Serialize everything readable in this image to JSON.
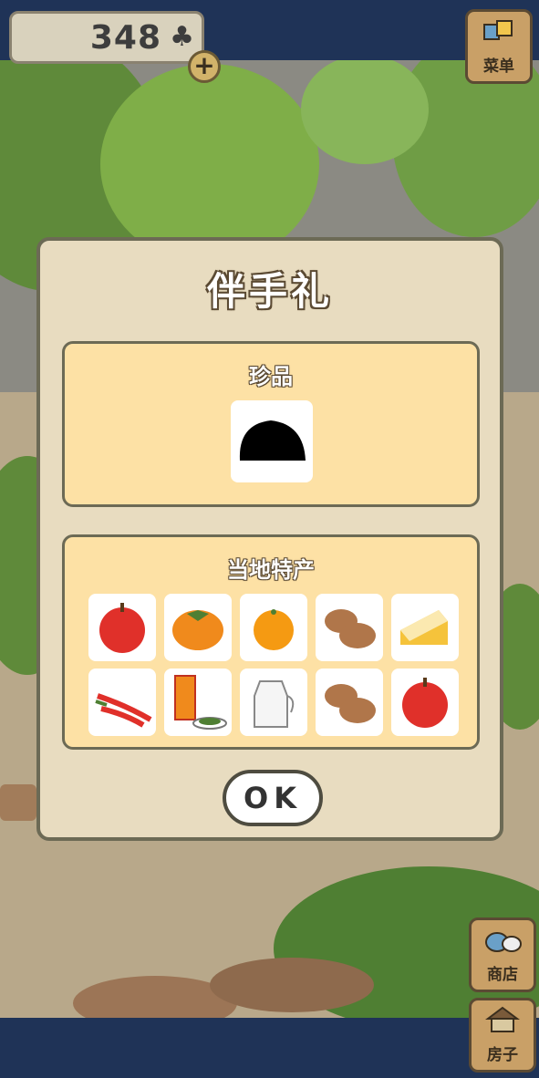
{
  "hud": {
    "clover_count": "348",
    "clover_icon": "♣",
    "add_label": "+"
  },
  "menu": {
    "label": "菜单"
  },
  "shop": {
    "label": "商店"
  },
  "house": {
    "label": "房子"
  },
  "dialog": {
    "title": "伴手礼",
    "rare_title": "珍品",
    "local_title": "当地特产",
    "ok_label": "OK"
  },
  "local_items": [
    "apple",
    "persimmon",
    "orange",
    "buns",
    "cheese",
    "chili-peppers",
    "canned-food-and-greens",
    "milk-jug",
    "buns",
    "apple"
  ]
}
